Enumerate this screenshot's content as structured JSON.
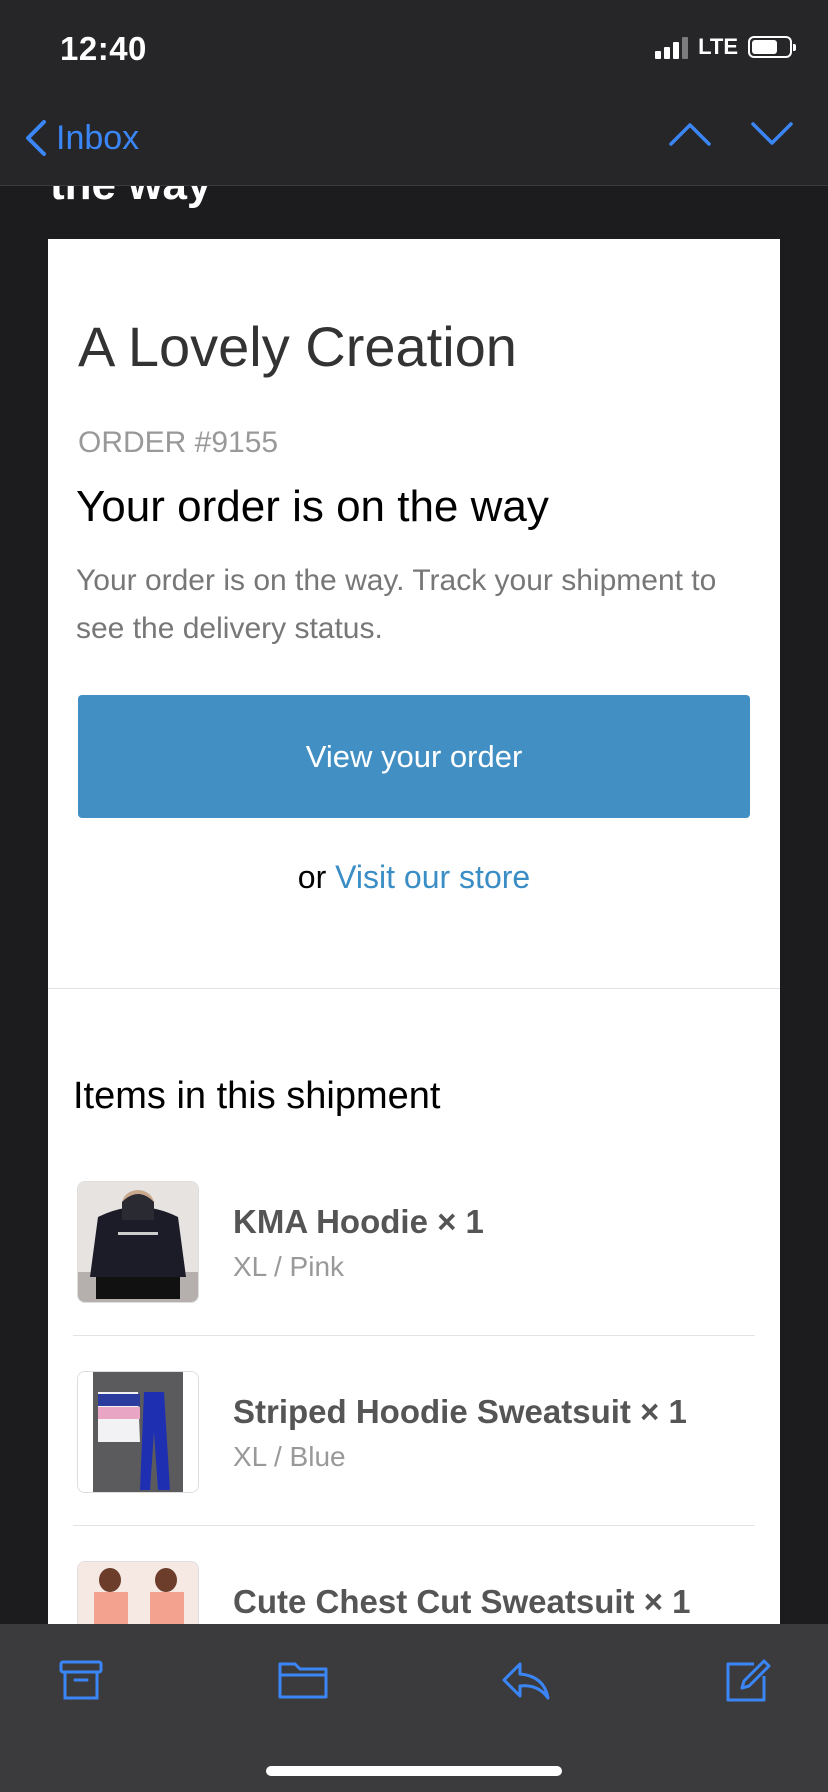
{
  "status_bar": {
    "time": "12:40",
    "network": "LTE"
  },
  "nav": {
    "back_label": "Inbox"
  },
  "subject_peek": "the way",
  "email": {
    "shop_name": "A Lovely Creation",
    "order_number": "ORDER #9155",
    "headline": "Your order is on the way",
    "description": "Your order is on the way. Track your shipment to see the delivery status.",
    "cta_label": "View your order",
    "or_text": "or",
    "store_link": "Visit our store",
    "items_title": "Items in this shipment",
    "items": [
      {
        "name": "KMA Hoodie × 1",
        "variant": "XL / Pink"
      },
      {
        "name": "Striped Hoodie Sweatsuit × 1",
        "variant": "XL / Blue"
      },
      {
        "name": "Cute Chest Cut Sweatsuit × 1",
        "variant": ""
      }
    ]
  },
  "toolbar": {
    "icons": [
      "archive-icon",
      "folder-icon",
      "reply-icon",
      "compose-icon"
    ]
  },
  "colors": {
    "accent": "#3b86f7",
    "cta": "#428fc4",
    "link": "#3b8ec5"
  }
}
